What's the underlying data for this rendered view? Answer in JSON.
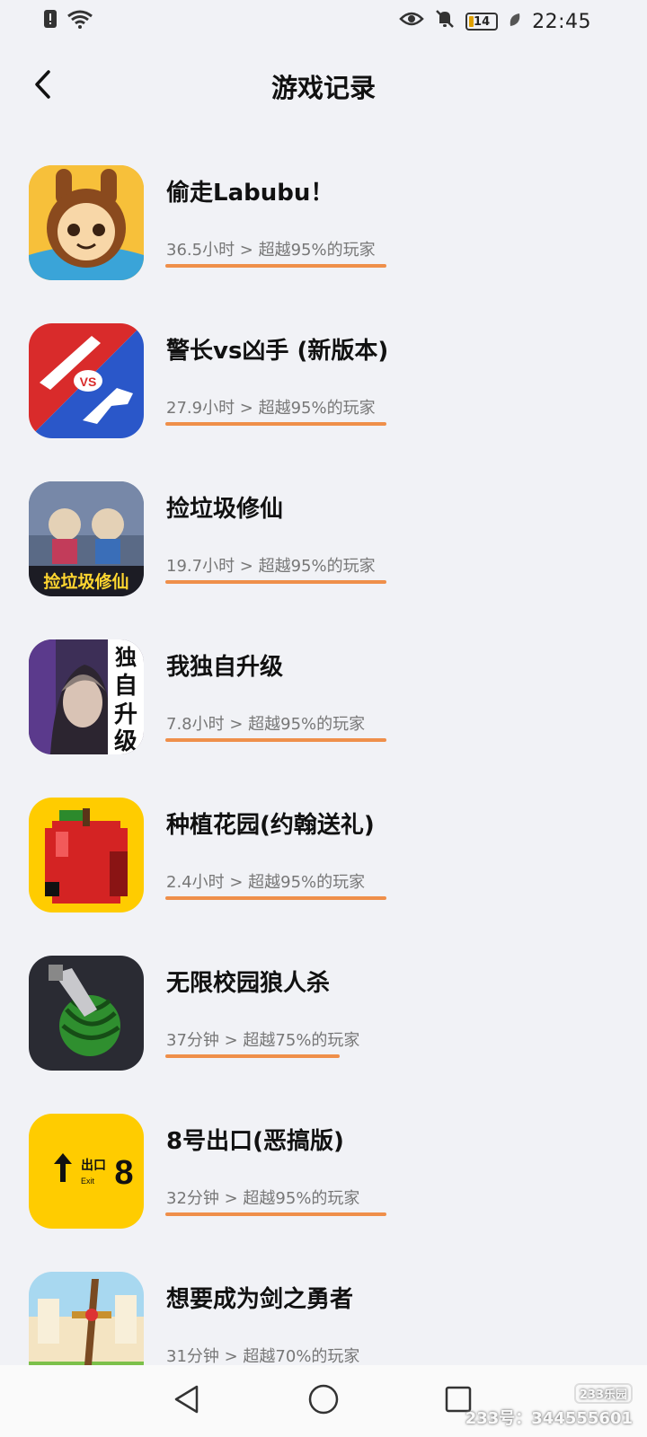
{
  "status_bar": {
    "time": "22:45",
    "battery": "14",
    "icons": [
      "alert-icon",
      "wifi-icon",
      "eye-icon",
      "mute-icon",
      "battery-icon",
      "leaf-icon"
    ]
  },
  "header": {
    "title": "游戏记录",
    "back_icon": "chevron-left-icon"
  },
  "games": [
    {
      "name": "偷走Labubu！",
      "stat": "36.5小时 > 超越95%的玩家",
      "beat_percent": 95,
      "icon_color": "#f6b41a"
    },
    {
      "name": "警长vs凶手 (新版本)",
      "stat": "27.9小时 > 超越95%的玩家",
      "beat_percent": 95,
      "icon_color": "#d72b2b"
    },
    {
      "name": "捡垃圾修仙",
      "stat": "19.7小时 > 超越95%的玩家",
      "beat_percent": 95,
      "icon_color": "#4b5a72"
    },
    {
      "name": "我独自升级",
      "stat": "7.8小时 > 超越95%的玩家",
      "beat_percent": 95,
      "icon_color": "#3d2f57"
    },
    {
      "name": "种植花园(约翰送礼)",
      "stat": "2.4小时 > 超越95%的玩家",
      "beat_percent": 95,
      "icon_color": "#ffcc00"
    },
    {
      "name": "无限校园狼人杀",
      "stat": "37分钟 > 超越75%的玩家",
      "beat_percent": 75,
      "icon_color": "#2a2b33"
    },
    {
      "name": "8号出口(恶搞版)",
      "stat": "32分钟 > 超越95%的玩家",
      "beat_percent": 95,
      "icon_color": "#ffcc00"
    },
    {
      "name": "想要成为剑之勇者",
      "stat": "31分钟 > 超越70%的玩家",
      "beat_percent": 70,
      "icon_color": "#a8d8f0"
    }
  ],
  "icon_texts": {
    "vs": "VS",
    "trash_title": "捡垃圾修仙",
    "solo_chars": [
      "独",
      "自",
      "升",
      "级"
    ],
    "exit_label": "出口",
    "exit_sub": "Exit",
    "exit_number": "8"
  },
  "watermark": {
    "logo": "233乐园",
    "id": "233号：344555601"
  }
}
